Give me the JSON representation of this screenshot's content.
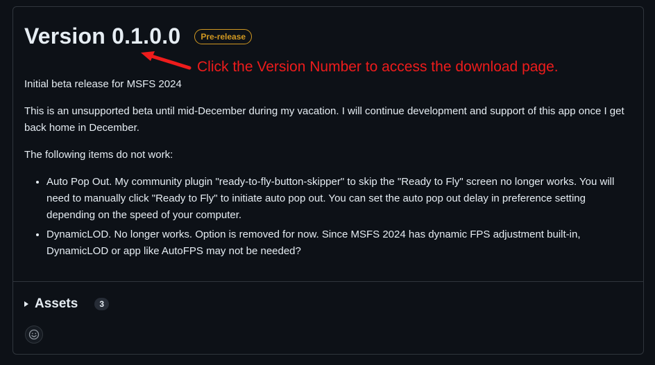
{
  "release": {
    "title": "Version 0.1.0.0",
    "badge": "Pre-release"
  },
  "annotation": {
    "text": "Click the Version Number to access the download page."
  },
  "notes": {
    "p1": "Initial beta release for MSFS 2024",
    "p2": "This is an unsupported beta until mid-December during my vacation. I will continue development and support of this app once I get back home in December.",
    "p3": "The following items do not work:",
    "items": [
      "Auto Pop Out. My community plugin \"ready-to-fly-button-skipper\" to skip the \"Ready to Fly\" screen no longer works. You will need to manually click \"Ready to Fly\" to initiate auto pop out. You can set the auto pop out delay in preference setting depending on the speed of your computer.",
      "DynamicLOD. No longer works. Option is removed for now. Since MSFS 2024 has dynamic FPS adjustment built-in, DynamicLOD or app like AutoFPS may not be needed?"
    ]
  },
  "assets": {
    "label": "Assets",
    "count": "3"
  },
  "icons": {
    "expand": "triangle-right-icon",
    "reaction": "smiley-icon",
    "annotation": "red-arrow-icon"
  },
  "colors": {
    "background": "#0d1117",
    "border": "#30363d",
    "badge": "#d29922",
    "annotation": "#ee1c1c",
    "text": "#e6edf3"
  }
}
